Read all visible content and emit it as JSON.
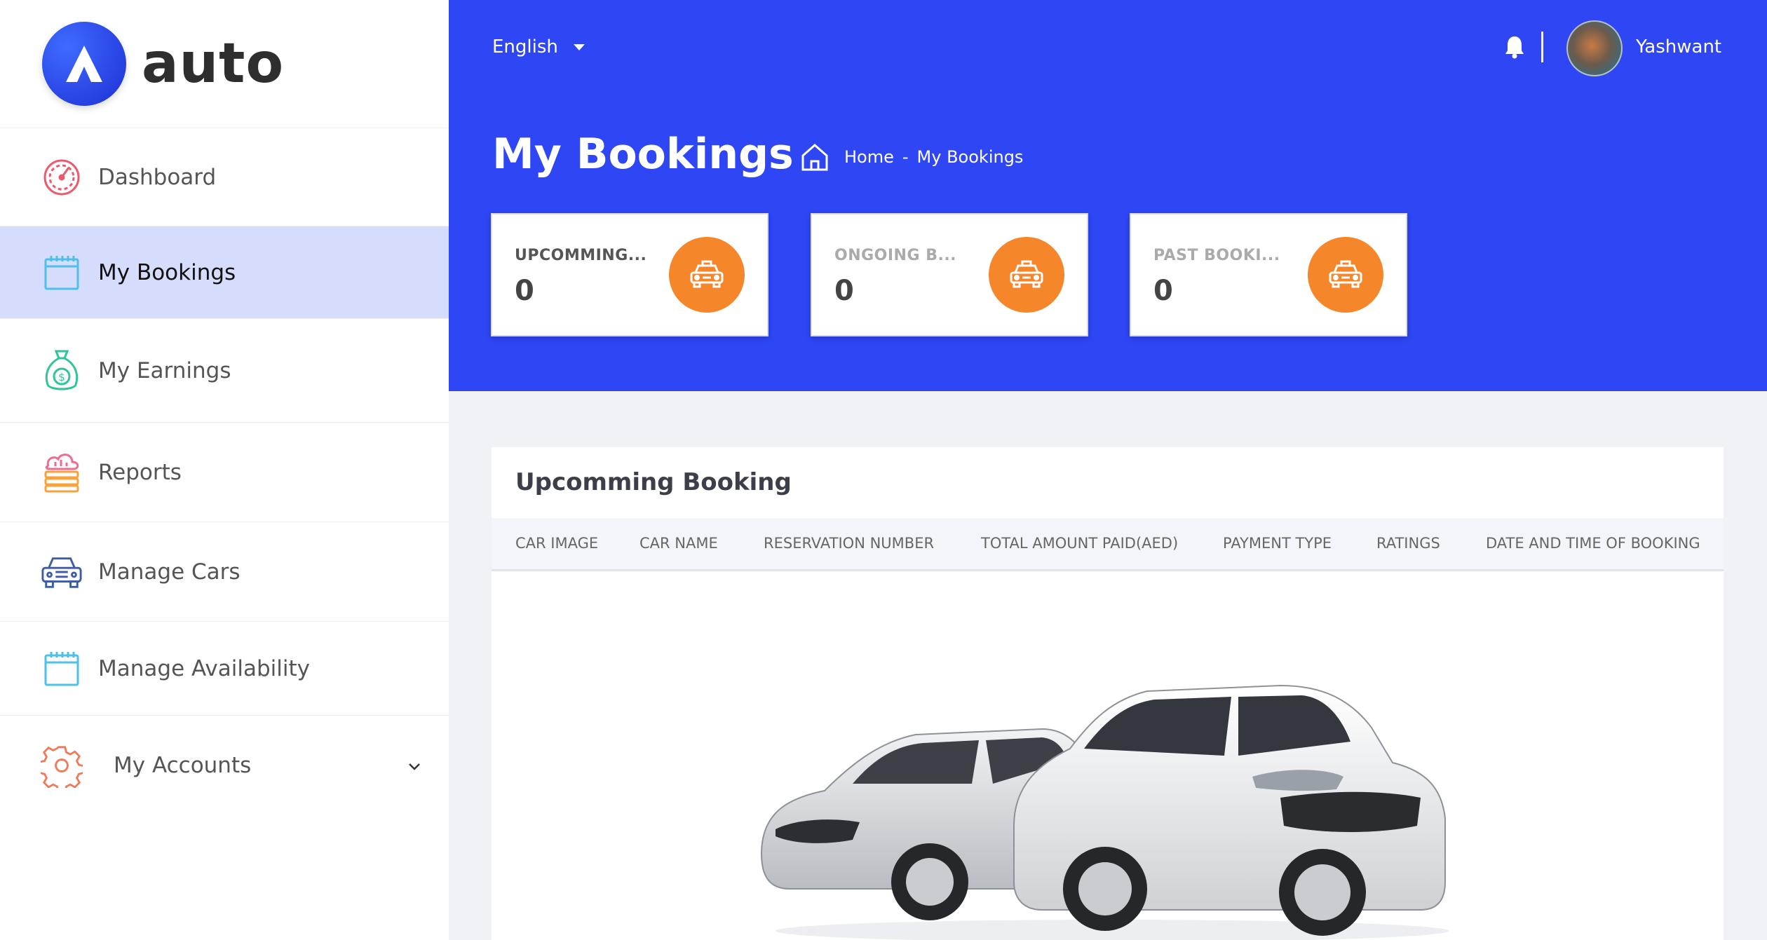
{
  "brand": {
    "name": "auto"
  },
  "sidebar": {
    "items": [
      {
        "label": "Dashboard",
        "icon": "speedometer-icon"
      },
      {
        "label": "My Bookings",
        "icon": "calendar-icon",
        "active": true
      },
      {
        "label": "My Earnings",
        "icon": "money-bag-icon"
      },
      {
        "label": "Reports",
        "icon": "reports-icon"
      },
      {
        "label": "Manage Cars",
        "icon": "car-icon"
      },
      {
        "label": "Manage Availability",
        "icon": "calendar-icon"
      },
      {
        "label": "My Accounts",
        "icon": "gear-icon"
      }
    ]
  },
  "header": {
    "language": "English",
    "user_name": "Yashwant",
    "page_title": "My Bookings",
    "breadcrumb": {
      "home": "Home",
      "separator": "-",
      "current": "My Bookings"
    }
  },
  "stats": [
    {
      "title": "UPCOMMING...",
      "value": "0",
      "title_color": "#555555"
    },
    {
      "title": "ONGOING B...",
      "value": "0",
      "title_color": "#aaaaaa"
    },
    {
      "title": "PAST BOOKI...",
      "value": "0",
      "title_color": "#aaaaaa"
    }
  ],
  "booking_card": {
    "title": "Upcomming Booking",
    "columns": [
      "CAR IMAGE",
      "CAR NAME",
      "RESERVATION NUMBER",
      "TOTAL AMOUNT PAID(AED)",
      "PAYMENT TYPE",
      "RATINGS",
      "DATE AND TIME OF BOOKING"
    ]
  },
  "colors": {
    "primary": "#2e46f4",
    "accent": "#f5862a",
    "active_bg": "#d6dcfb",
    "page_bg": "#f1f2f7"
  }
}
